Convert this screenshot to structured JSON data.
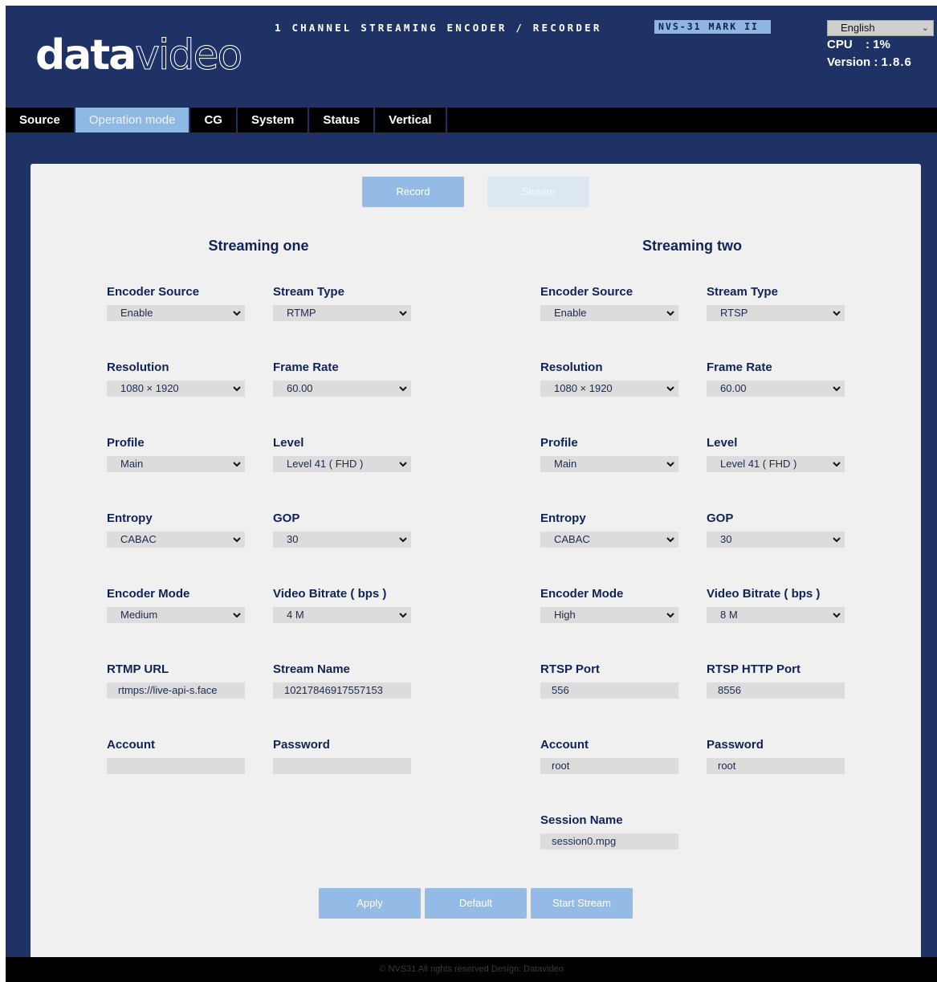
{
  "header": {
    "logo_part1": "data",
    "logo_part2": "video",
    "product_title": "1 CHANNEL STREAMING ENCODER / RECORDER",
    "model_badge": "NVS-31 MARK II",
    "language": "English",
    "cpu_label": "CPU",
    "cpu_value": ": 1%",
    "version_label": "Version :",
    "version_value": "1.8.6"
  },
  "nav": {
    "tabs": [
      {
        "label": "Source",
        "active": false
      },
      {
        "label": "Operation mode",
        "active": true
      },
      {
        "label": "CG",
        "active": false
      },
      {
        "label": "System",
        "active": false
      },
      {
        "label": "Status",
        "active": false
      },
      {
        "label": "Vertical",
        "active": false
      }
    ]
  },
  "mode": {
    "record_label": "Record",
    "stream_label": "Stream"
  },
  "streaming_one": {
    "title": "Streaming one",
    "encoder_source": {
      "label": "Encoder Source",
      "value": "Enable"
    },
    "stream_type": {
      "label": "Stream Type",
      "value": "RTMP"
    },
    "resolution": {
      "label": "Resolution",
      "value": "1080 × 1920"
    },
    "frame_rate": {
      "label": "Frame Rate",
      "value": "60.00"
    },
    "profile": {
      "label": "Profile",
      "value": "Main"
    },
    "level": {
      "label": "Level",
      "value": "Level 41 ( FHD )"
    },
    "entropy": {
      "label": "Entropy",
      "value": "CABAC"
    },
    "gop": {
      "label": "GOP",
      "value": "30"
    },
    "encoder_mode": {
      "label": "Encoder Mode",
      "value": "Medium"
    },
    "video_bitrate": {
      "label": "Video Bitrate ( bps )",
      "value": "4 M"
    },
    "rtmp_url": {
      "label": "RTMP URL",
      "value": "rtmps://live-api-s.face"
    },
    "stream_name": {
      "label": "Stream Name",
      "value": "10217846917557153"
    },
    "account": {
      "label": "Account",
      "value": ""
    },
    "password": {
      "label": "Password",
      "value": ""
    }
  },
  "streaming_two": {
    "title": "Streaming two",
    "encoder_source": {
      "label": "Encoder Source",
      "value": "Enable"
    },
    "stream_type": {
      "label": "Stream Type",
      "value": "RTSP"
    },
    "resolution": {
      "label": "Resolution",
      "value": "1080 × 1920"
    },
    "frame_rate": {
      "label": "Frame Rate",
      "value": "60.00"
    },
    "profile": {
      "label": "Profile",
      "value": "Main"
    },
    "level": {
      "label": "Level",
      "value": "Level 41 ( FHD )"
    },
    "entropy": {
      "label": "Entropy",
      "value": "CABAC"
    },
    "gop": {
      "label": "GOP",
      "value": "30"
    },
    "encoder_mode": {
      "label": "Encoder Mode",
      "value": "High"
    },
    "video_bitrate": {
      "label": "Video Bitrate ( bps )",
      "value": "8 M"
    },
    "rtsp_port": {
      "label": "RTSP Port",
      "value": "556"
    },
    "rtsp_http_port": {
      "label": "RTSP HTTP Port",
      "value": "8556"
    },
    "account": {
      "label": "Account",
      "value": "root"
    },
    "password": {
      "label": "Password",
      "value": "root"
    },
    "session_name": {
      "label": "Session Name",
      "value": "session0.mpg"
    }
  },
  "actions": {
    "apply_label": "Apply",
    "default_label": "Default",
    "start_stream_label": "Start Stream"
  },
  "footer": {
    "text": "© NVS31 All rights reserved Design: Datavideo"
  },
  "colors": {
    "header_bg": "#1e3265",
    "panel_bg": "#f0f0f0",
    "accent": "#94bbe5",
    "label_text": "#102356"
  }
}
